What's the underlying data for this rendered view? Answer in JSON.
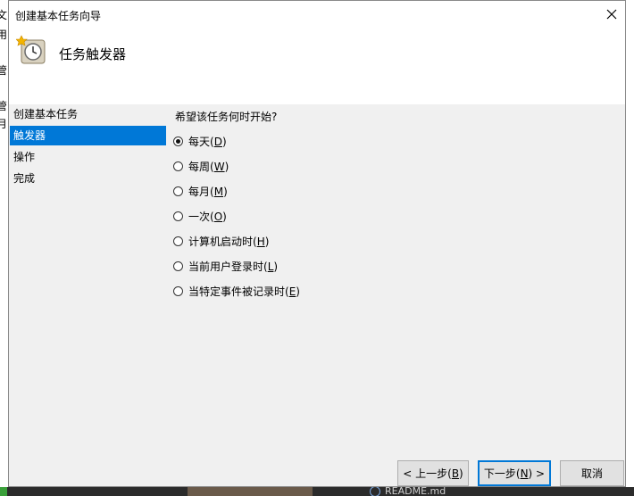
{
  "window": {
    "title": "创建基本任务向导",
    "heading": "任务触发器"
  },
  "background": {
    "left_chars": [
      "文",
      "用",
      "管",
      "管",
      "月"
    ],
    "taskbar_text": "README.md"
  },
  "sidebar": {
    "items": [
      {
        "label": "创建基本任务",
        "selected": false
      },
      {
        "label": "触发器",
        "selected": true
      },
      {
        "label": "操作",
        "selected": false
      },
      {
        "label": "完成",
        "selected": false
      }
    ]
  },
  "content": {
    "question": "希望该任务何时开始?",
    "options": [
      {
        "label": "每天",
        "key": "D",
        "checked": true
      },
      {
        "label": "每周",
        "key": "W",
        "checked": false
      },
      {
        "label": "每月",
        "key": "M",
        "checked": false
      },
      {
        "label": "一次",
        "key": "O",
        "checked": false
      },
      {
        "label": "计算机启动时",
        "key": "H",
        "checked": false
      },
      {
        "label": "当前用户登录时",
        "key": "L",
        "checked": false
      },
      {
        "label": "当特定事件被记录时",
        "key": "E",
        "checked": false
      }
    ]
  },
  "buttons": {
    "back": {
      "text": "< 上一步(",
      "key": "B",
      "suffix": ")"
    },
    "next": {
      "text": "下一步(",
      "key": "N",
      "suffix": ") >"
    },
    "cancel": {
      "text": "取消"
    }
  },
  "colors": {
    "accent": "#0078d7",
    "dialog_bg": "#f0f0f0"
  },
  "icons": {
    "header": "scheduled-task-clock-icon",
    "close": "close-icon"
  }
}
